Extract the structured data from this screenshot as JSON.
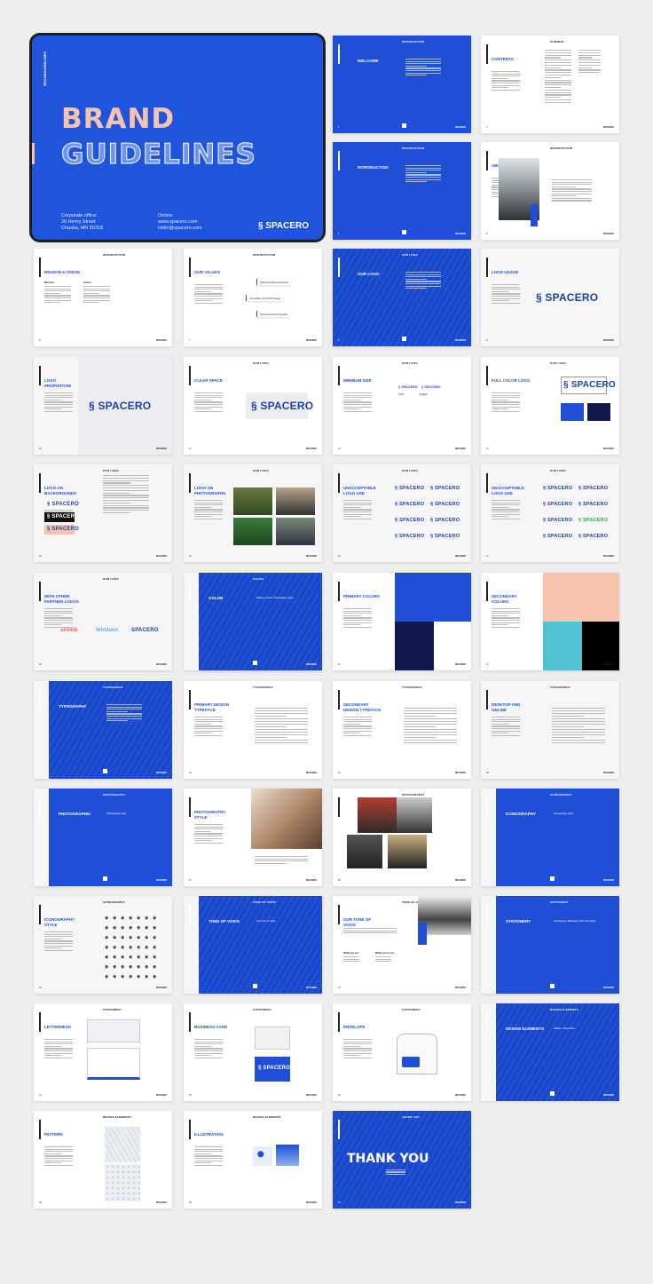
{
  "colors": {
    "brand_blue": "#1f4fd6",
    "navy": "#111a4c",
    "pink": "#f6c4ae",
    "teal": "#4fc3d3",
    "black": "#000000",
    "background": "#eeeeef"
  },
  "cover": {
    "vertical_label": "BRANDGUIDELINES",
    "title_line1": "BRAND",
    "title_line2": "GUIDELINES",
    "office_label": "Corporate office:",
    "office_line1": "26 Henry Street",
    "office_line2": "Chaska, MN 55318",
    "online_label": "Online:",
    "online_line1": "www.spacero.com",
    "online_line2": "Hello@spacero.com",
    "logo": "SPACERO",
    "logo_icon": "spacero-s-icon"
  },
  "footer_brand": "SPACERO",
  "slides": [
    {
      "title": "Welcome",
      "section": "INTRODUCTION",
      "theme": "blue"
    },
    {
      "title": "Contents",
      "section": "CONTENT",
      "theme": "white",
      "visual": "contents"
    },
    {
      "title": "Introduction",
      "section": "INTRODUCTION",
      "theme": "blue"
    },
    {
      "title": "About",
      "section": "INTRODUCTION",
      "theme": "white",
      "visual": "portrait"
    },
    {
      "title": "Mission & Vision",
      "section": "INTRODUCTION",
      "theme": "white",
      "visual": "mission",
      "labels": [
        "Mission",
        "Vision"
      ]
    },
    {
      "title": "Our Values",
      "section": "INTRODUCTION",
      "theme": "white",
      "visual": "values",
      "items": [
        "Sharing and connecting",
        "Innovation and technology",
        "Openness and integrity"
      ]
    },
    {
      "title": "Our Logo",
      "section": "OUR LOGO",
      "theme": "blue"
    },
    {
      "title": "Logo Usage",
      "section": "OUR LOGO",
      "theme": "light",
      "visual": "logo",
      "logo": "SPACERO"
    },
    {
      "title": "Logo Proportion",
      "section": "OUR LOGO",
      "theme": "light",
      "visual": "logo",
      "logo": "SPACERO"
    },
    {
      "title": "Clear Space",
      "section": "OUR LOGO",
      "theme": "white",
      "visual": "logo",
      "logo": "SPACERO"
    },
    {
      "title": "Minimum Size",
      "section": "OUR LOGO",
      "theme": "white",
      "visual": "minsize",
      "labels": [
        "Print",
        "Digital"
      ]
    },
    {
      "title": "Full Color Logo",
      "section": "OUR LOGO",
      "theme": "white",
      "visual": "fullcolor",
      "logo": "SPACERO"
    },
    {
      "title": "Logo on Backgrounds",
      "section": "OUR LOGO",
      "theme": "light",
      "visual": "backgrounds",
      "logo": "SPACERO"
    },
    {
      "title": "Logo on Photographs",
      "section": "OUR LOGO",
      "theme": "light",
      "visual": "photos4"
    },
    {
      "title": "Unacceptable Logo Use",
      "section": "OUR LOGO",
      "theme": "light",
      "visual": "unacceptable",
      "logo": "SPACERO"
    },
    {
      "title": "Unacceptable Logo Use",
      "section": "OUR LOGO",
      "theme": "light",
      "visual": "unacceptable",
      "logo": "SPACERO"
    },
    {
      "title": "With Other Partner Logos",
      "section": "OUR LOGO",
      "theme": "light",
      "visual": "partners",
      "partners": [
        "airbnb",
        "Windows",
        "SPACERO"
      ]
    },
    {
      "title": "Color",
      "section": "COLOR",
      "theme": "blue-strip",
      "subtitle": "Primary colors / Secondary colors"
    },
    {
      "title": "Primary Colors",
      "section": "COLOR",
      "theme": "white",
      "visual": "primary"
    },
    {
      "title": "Secondary Colors",
      "section": "COLOR",
      "theme": "white",
      "visual": "secondary"
    },
    {
      "title": "Typography",
      "section": "TYPOGRAPHY",
      "theme": "blue-strip"
    },
    {
      "title": "Primary Design Typeface",
      "section": "TYPOGRAPHY",
      "theme": "white",
      "visual": "type"
    },
    {
      "title": "Secondary Design Typeface",
      "section": "TYPOGRAPHY",
      "theme": "white",
      "visual": "type"
    },
    {
      "title": "Desktop and Online",
      "section": "TYPOGRAPHY",
      "theme": "light",
      "visual": "type"
    },
    {
      "title": "Photographic",
      "section": "PHOTOGRAPHY",
      "theme": "blue-strip",
      "subtitle": "Photography style"
    },
    {
      "title": "Photography Style",
      "section": "PHOTOGRAPHY",
      "theme": "white",
      "visual": "bigphoto"
    },
    {
      "title": "",
      "section": "PHOTOGRAPHY",
      "theme": "white",
      "visual": "photogrid"
    },
    {
      "title": "Iconography",
      "section": "ICONOGRAPHY",
      "theme": "blue-strip",
      "subtitle": "Iconography style"
    },
    {
      "title": "Iconography Style",
      "section": "ICONOGRAPHY",
      "theme": "light",
      "visual": "icons"
    },
    {
      "title": "Tone of Voice",
      "section": "TONE OF VOICE",
      "theme": "blue-strip",
      "subtitle": "Our tone of voice"
    },
    {
      "title": "Our Tone of Voice",
      "section": "TONE OF VOICE",
      "theme": "white",
      "visual": "tone",
      "labels": [
        "What we are",
        "What we're not"
      ]
    },
    {
      "title": "Stationery",
      "section": "STATIONERY",
      "theme": "blue-strip",
      "subtitle": "Letterhead / Business card / Envelope"
    },
    {
      "title": "Letterhead",
      "section": "STATIONERY",
      "theme": "white",
      "visual": "letterhead"
    },
    {
      "title": "Business Card",
      "section": "STATIONERY",
      "theme": "white",
      "visual": "card",
      "logo": "SPACERO"
    },
    {
      "title": "Envelope",
      "section": "STATIONERY",
      "theme": "white",
      "visual": "envelope"
    },
    {
      "title": "Design Elements",
      "section": "DESIGN ELEMENTS",
      "theme": "blue-strip",
      "subtitle": "Pattern / Illustration"
    },
    {
      "title": "Pattern",
      "section": "DESIGN ELEMENTS",
      "theme": "white",
      "visual": "pattern"
    },
    {
      "title": "Illustration",
      "section": "DESIGN ELEMENTS",
      "theme": "white",
      "visual": "illustration"
    },
    {
      "title": "Thank You",
      "section": "THANK YOU",
      "theme": "blue-full-big"
    }
  ]
}
